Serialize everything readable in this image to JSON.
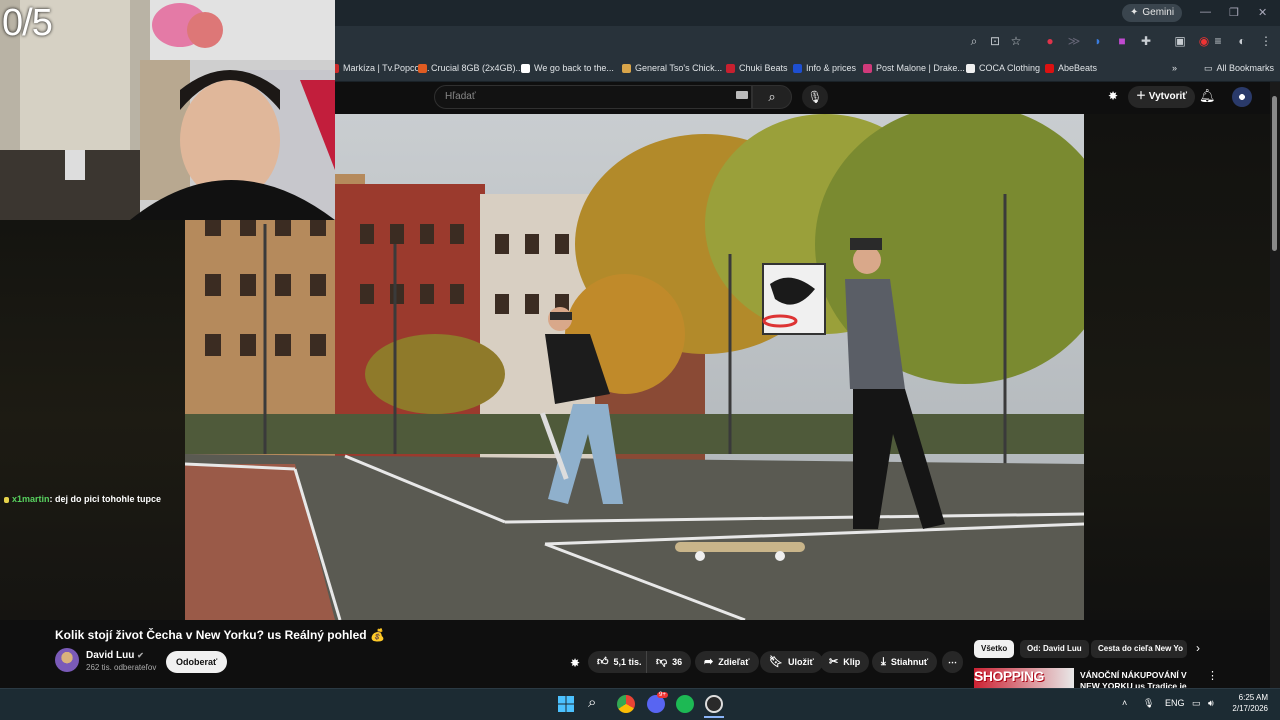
{
  "overlay": {
    "counter": "0/5",
    "chat": {
      "user": "x1martin",
      "message": ": dej do pici tohohle tupce"
    }
  },
  "browser": {
    "gemini_label": "Gemini",
    "bookmarks": [
      {
        "label": "Markíza | Tv.Popcor...",
        "color": "#cc2a2a"
      },
      {
        "label": "Crucial 8GB (2x4GB)...",
        "color": "#e05b21"
      },
      {
        "label": "We go back to the...",
        "color": "#ffffff"
      },
      {
        "label": "General Tso's Chick...",
        "color": "#d9a54a"
      },
      {
        "label": "Chuki Beats",
        "color": "#c8202f"
      },
      {
        "label": "Info & prices",
        "color": "#1e4fd1"
      },
      {
        "label": "Post Malone | Drake...",
        "color": "#d03a7a"
      },
      {
        "label": "COCA Clothing",
        "color": "#f0f0f0"
      },
      {
        "label": "AbeBeats",
        "color": "#d11"
      }
    ],
    "all_bookmarks": "All Bookmarks"
  },
  "youtube": {
    "search_placeholder": "Hľadať",
    "create_label": "Vytvoriť",
    "video_title": "Kolik stojí život Čecha v New Yorku? us Reálný pohled 💰",
    "channel_name": "David Luu",
    "channel_subs": "262 tis. odberateľov",
    "subscribe_label": "Odoberať",
    "likes": "5,1 tis.",
    "dislikes": "36",
    "share": "Zdieľať",
    "save": "Uložiť",
    "clip": "Klip",
    "download": "Stiahnuť",
    "chips": [
      "Všetko",
      "Od: David Luu",
      "Cesta do cieľa New Yo"
    ],
    "recommendation": {
      "thumb_text": "SHOPPING",
      "title": "VÁNOČNÍ NÁKUPOVÁNÍ V NEW YORKU us Tradice je tradice"
    }
  },
  "taskbar": {
    "lang": "ENG",
    "time": "6:25 AM",
    "date": "2/17/2026",
    "discord_badge": "9+"
  }
}
